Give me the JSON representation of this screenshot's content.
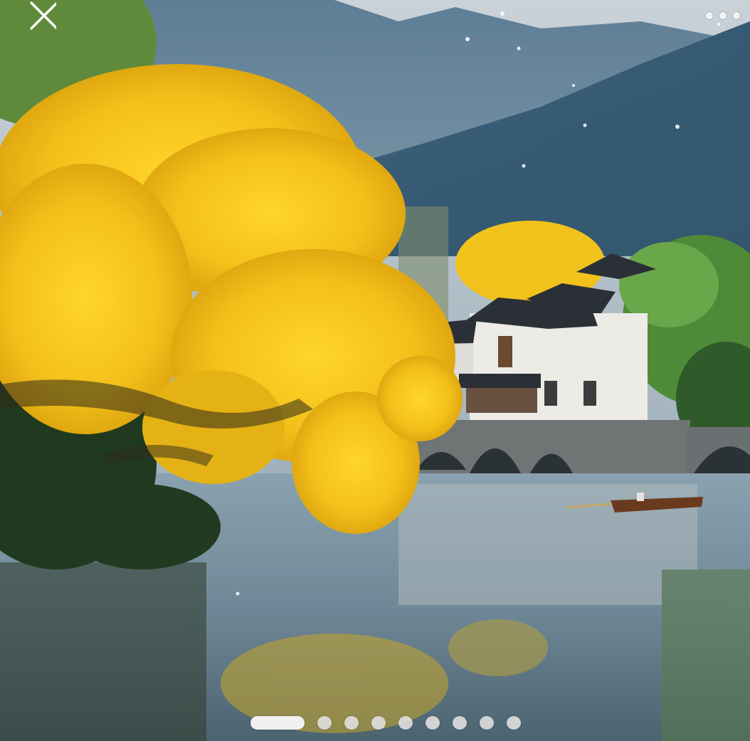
{
  "viewer": {
    "close_icon": "close-icon",
    "more_icon": "more-dots-icon",
    "pager": {
      "total": 9,
      "current_index": 0
    },
    "colors": {
      "blossom": "#f5c51c",
      "mountain": "#4f6f86",
      "water": "#6f8796",
      "house_wall": "#ecebe6",
      "roof": "#2b2f36"
    }
  }
}
